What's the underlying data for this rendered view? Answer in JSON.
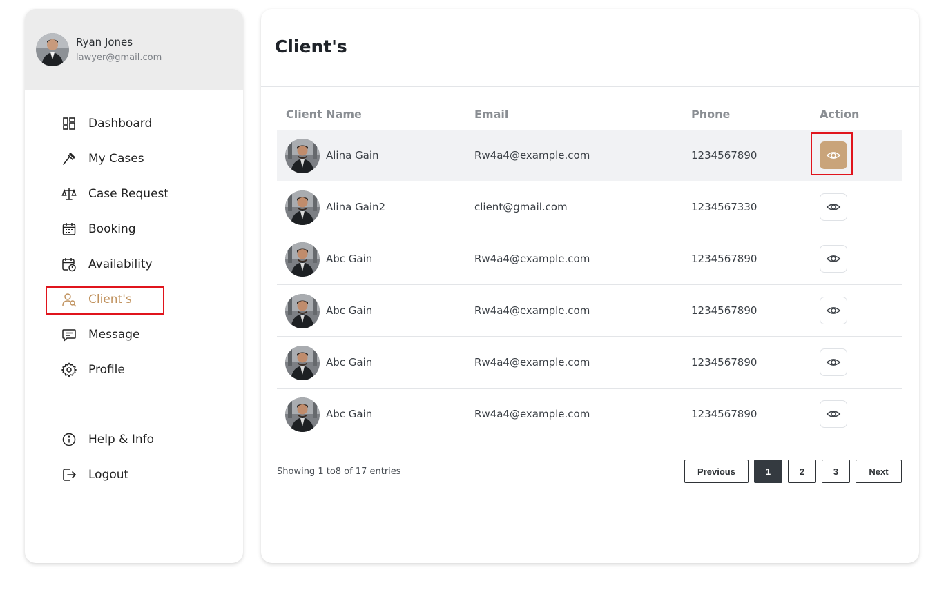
{
  "user": {
    "name": "Ryan Jones",
    "email": "lawyer@gmail.com"
  },
  "nav": [
    {
      "label": "Dashboard",
      "icon": "dashboard-icon"
    },
    {
      "label": "My Cases",
      "icon": "gavel-icon"
    },
    {
      "label": "Case Request",
      "icon": "scales-icon"
    },
    {
      "label": "Booking",
      "icon": "calendar-icon"
    },
    {
      "label": "Availability",
      "icon": "calendar-clock-icon"
    },
    {
      "label": "Client's",
      "icon": "user-search-icon",
      "active": true
    },
    {
      "label": "Message",
      "icon": "message-icon"
    },
    {
      "label": "Profile",
      "icon": "gear-icon"
    },
    {
      "label": "Help & Info",
      "icon": "info-icon"
    },
    {
      "label": "Logout",
      "icon": "logout-icon"
    }
  ],
  "page": {
    "title": "Client's"
  },
  "table": {
    "headers": [
      "Client Name",
      "Email",
      "Phone",
      "Action"
    ],
    "rows": [
      {
        "name": "Alina Gain",
        "email": "Rw4a4@example.com",
        "phone": "1234567890"
      },
      {
        "name": "Alina Gain2",
        "email": "client@gmail.com",
        "phone": "1234567330"
      },
      {
        "name": "Abc Gain",
        "email": "Rw4a4@example.com",
        "phone": "1234567890"
      },
      {
        "name": "Abc Gain",
        "email": "Rw4a4@example.com",
        "phone": "1234567890"
      },
      {
        "name": "Abc Gain",
        "email": "Rw4a4@example.com",
        "phone": "1234567890"
      },
      {
        "name": "Abc Gain",
        "email": "Rw4a4@example.com",
        "phone": "1234567890"
      }
    ]
  },
  "pagination": {
    "entries_text": "Showing 1  to8  of 17 entries",
    "previous": "Previous",
    "pages": [
      "1",
      "2",
      "3"
    ],
    "current_page": "1",
    "next": "Next"
  },
  "colors": {
    "accent": "#c0925e",
    "action_active": "#c9a47a",
    "highlight": "#e0141c"
  }
}
